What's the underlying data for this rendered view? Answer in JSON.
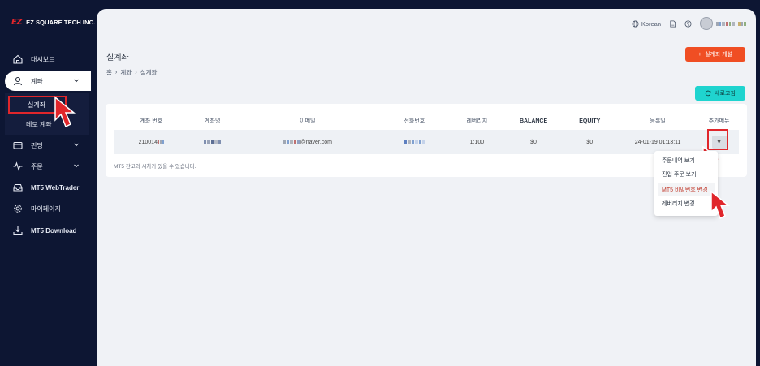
{
  "brand": {
    "mark": "EZ",
    "name": "EZ SQUARE TECH INC.",
    "color": "#e0262b"
  },
  "sidebar": {
    "items": [
      {
        "label": "대시보드",
        "icon": "home-icon"
      },
      {
        "label": "계좌",
        "icon": "user-icon"
      },
      {
        "label": "펀딩",
        "icon": "wallet-icon"
      },
      {
        "label": "주문",
        "icon": "activity-icon"
      },
      {
        "label": "MT5 WebTrader",
        "icon": "inbox-icon"
      },
      {
        "label": "마이페이지",
        "icon": "gear-icon"
      },
      {
        "label": "MT5 Download",
        "icon": "download-icon"
      }
    ],
    "submenu": [
      {
        "label": "실계좌"
      },
      {
        "label": "데모 계좌"
      }
    ]
  },
  "topbar": {
    "language": "Korean"
  },
  "page": {
    "title": "실계좌",
    "breadcrumb": [
      "홈",
      "계좌",
      "실계좌"
    ]
  },
  "buttons": {
    "open_account": "실계좌 개설",
    "refresh": "새로고침"
  },
  "table": {
    "columns": [
      "계좌 번호",
      "계좌명",
      "이메일",
      "전화번호",
      "레버리지",
      "BALANCE",
      "EQUITY",
      "등록일",
      "추가메뉴"
    ],
    "row": {
      "account_no": "210014",
      "email_suffix": "@naver.com",
      "leverage": "1:100",
      "balance": "$0",
      "equity": "$0",
      "registered": "24-01-19 01:13:11"
    },
    "note": "MT5 잔고와 시차가 있을 수 있습니다."
  },
  "dropdown": {
    "items": [
      {
        "label": "주문내역 보기"
      },
      {
        "label": "진입 주문 보기"
      },
      {
        "label": "MT5 비밀번호 변경"
      },
      {
        "label": "레버리지 변경"
      }
    ]
  },
  "colors": {
    "accent": "#f04e23",
    "teal": "#1fd4cf",
    "sidebar_bg": "#0d1633",
    "highlight": "#e0262b"
  }
}
